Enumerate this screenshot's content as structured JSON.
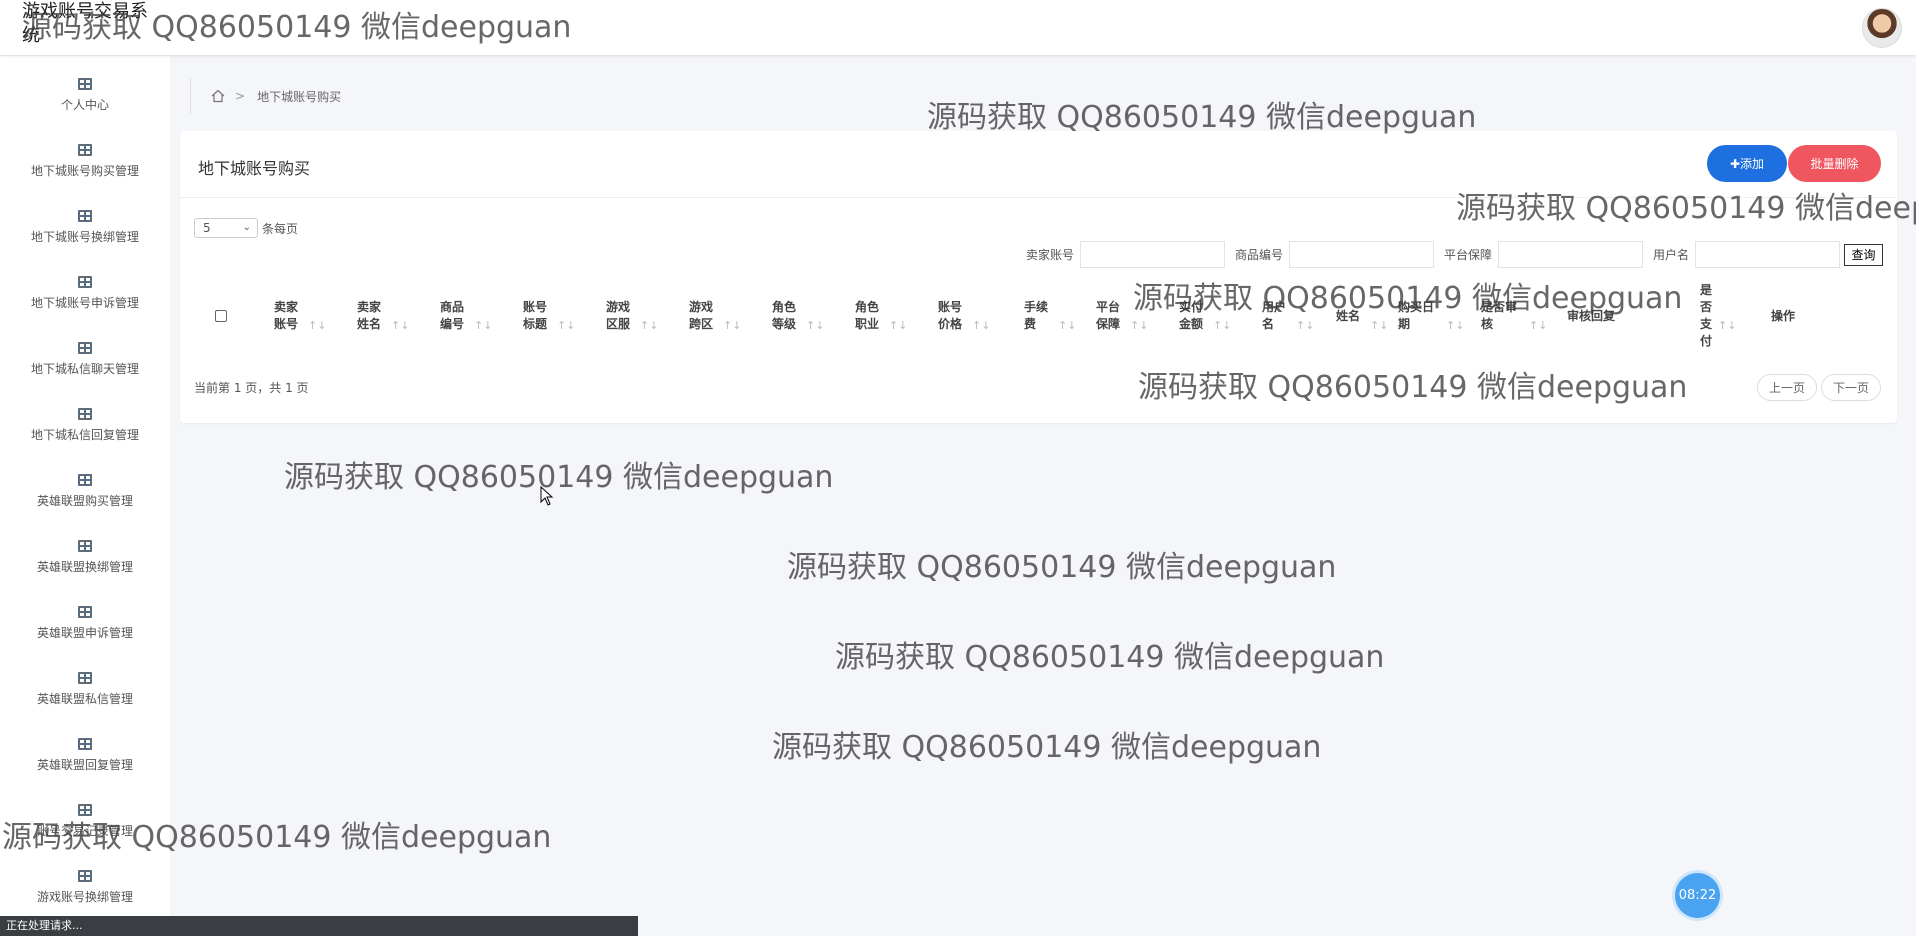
{
  "app": {
    "title": "游戏账号交易系统"
  },
  "sidebar": {
    "items": [
      {
        "label": "个人中心"
      },
      {
        "label": "地下城账号购买管理"
      },
      {
        "label": "地下城账号换绑管理"
      },
      {
        "label": "地下城账号申诉管理"
      },
      {
        "label": "地下城私信聊天管理"
      },
      {
        "label": "地下城私信回复管理"
      },
      {
        "label": "英雄联盟购买管理"
      },
      {
        "label": "英雄联盟换绑管理"
      },
      {
        "label": "英雄联盟申诉管理"
      },
      {
        "label": "英雄联盟私信管理"
      },
      {
        "label": "英雄联盟回复管理"
      },
      {
        "label": "账号交易记录管理"
      },
      {
        "label": "游戏账号换绑管理"
      }
    ]
  },
  "breadcrumb": {
    "current": "地下城账号购买"
  },
  "main": {
    "title": "地下城账号购买",
    "add_label": "✚添加",
    "batch_delete_label": "批量删除",
    "page_size": "5",
    "page_size_suffix": "条每页",
    "search": {
      "fields": [
        "卖家账号",
        "商品编号",
        "平台保障",
        "用户名"
      ],
      "query_label": "查询"
    },
    "columns": [
      "卖家账号",
      "卖家姓名",
      "商品编号",
      "账号标题",
      "游戏区服",
      "游戏跨区",
      "角色等级",
      "角色职业",
      "账号价格",
      "手续费",
      "平台保障",
      "实付金额",
      "用户名",
      "姓名",
      "购买日期",
      "是否审核",
      "审核回复",
      "是否支付",
      "操作"
    ],
    "page_info": "当前第 1 页，共 1 页",
    "prev_label": "上一页",
    "next_label": "下一页"
  },
  "clock": "08:22",
  "status_text": "正在处理请求...",
  "watermark": "源码获取 QQ86050149 微信deepguan"
}
